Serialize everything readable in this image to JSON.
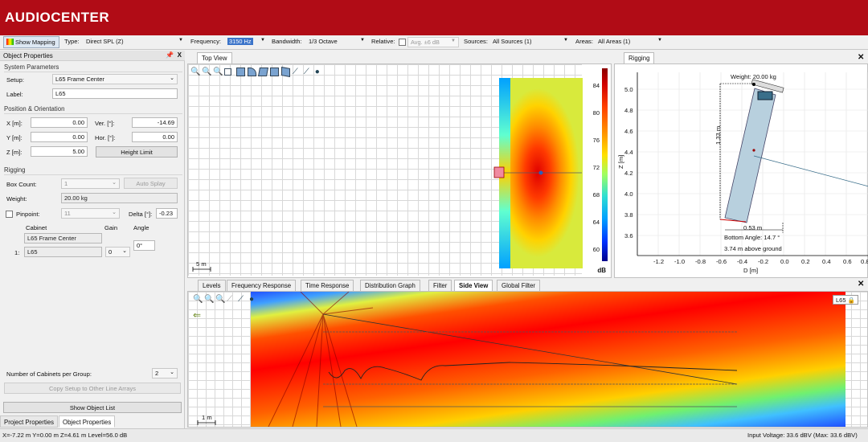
{
  "app": {
    "brand": "AUDIOCENTER"
  },
  "toolbar": {
    "show_mapping": "Show Mapping",
    "type_label": "Type:",
    "type_value": "Direct SPL (Z)",
    "frequency_label": "Frequency:",
    "frequency_value": "3150 Hz",
    "bandwidth_label": "Bandwidth:",
    "bandwidth_value": "1/3 Octave",
    "relative_label": "Relative:",
    "avg_value": "Avg. ±6 dB",
    "sources_label": "Sources:",
    "sources_value": "All Sources (1)",
    "areas_label": "Areas:",
    "areas_value": "All Areas (1)"
  },
  "object_properties": {
    "title": "Object Properties",
    "pin": "ᴾ",
    "close": "X",
    "system_parameters": "System Parameters",
    "setup_label": "Setup:",
    "setup_value": "L65 Frame Center",
    "label_label": "Label:",
    "label_value": "L65",
    "position_orientation": "Position & Orientation",
    "x_label": "X [m]:",
    "x_value": "0.00",
    "y_label": "Y [m]:",
    "y_value": "0.00",
    "z_label": "Z [m]:",
    "z_value": "5.00",
    "ver_label": "Ver. [°]:",
    "ver_value": "-14.69",
    "hor_label": "Hor. [°]:",
    "hor_value": "0.00",
    "height_limit": "Height Limit",
    "rigging": "Rigging",
    "box_count_label": "Box Count:",
    "box_count_value": "1",
    "auto_splay": "Auto Splay",
    "weight_label": "Weight:",
    "weight_value": "20.00 kg",
    "pinpoint_label": "Pinpoint:",
    "pinpoint_value": "11",
    "delta_label": "Delta [°]:",
    "delta_value": "-0.23",
    "cabinet_header": "Cabinet",
    "gain_header": "Gain",
    "angle_header": "Angle",
    "frame_value": "L65 Frame Center",
    "angle_value": "0°",
    "row_index": "1:",
    "cabinet_value": "L65",
    "gain_value": "0",
    "cabinets_per_group_label": "Number of Cabinets per Group:",
    "cabinets_per_group_value": "2",
    "copy_setup": "Copy Setup to Other Line Arrays",
    "show_object_list": "Show Object List",
    "tabs": [
      "Project Properties",
      "Object Properties"
    ]
  },
  "top_view": {
    "tab": "Top View",
    "scale_label": "5 m",
    "colorbar_ticks": [
      "84",
      "80",
      "76",
      "72",
      "68",
      "64",
      "60"
    ],
    "colorbar_unit": "dB"
  },
  "rigging": {
    "tab": "Rigging",
    "weight": "Weight: 20.00 kg",
    "height_dim": "1.33 m",
    "width_dim": "0.53 m",
    "bottom_angle": "Bottom Angle: 14.7 °",
    "above_ground": "3.74 m above ground",
    "ylabel": "Z [m]",
    "xlabel": "D [m]",
    "y_ticks": [
      "5.0",
      "4.8",
      "4.6",
      "4.4",
      "4.2",
      "4.0",
      "3.8",
      "3.6"
    ],
    "x_ticks": [
      "-1.2",
      "-1.0",
      "-0.8",
      "-0.6",
      "-0.4",
      "-0.2",
      "0.0",
      "0.2",
      "0.4",
      "0.6",
      "0.8"
    ]
  },
  "bottom_tabs": [
    "Levels",
    "Frequency Response",
    "Time Response",
    "Distribution Graph",
    "Filter",
    "Side View",
    "Global Filter"
  ],
  "side_view": {
    "scale_label": "1 m",
    "badge": "L65"
  },
  "status": {
    "left": "X=-7.22 m Y=0.00 m Z=4.61 m Level=56.0 dB",
    "right": "Input Voltage: 33.6 dBV (Max: 33.6 dBV)"
  },
  "colors": {
    "brand": "#b10c16",
    "selection": "#3a73c9"
  }
}
